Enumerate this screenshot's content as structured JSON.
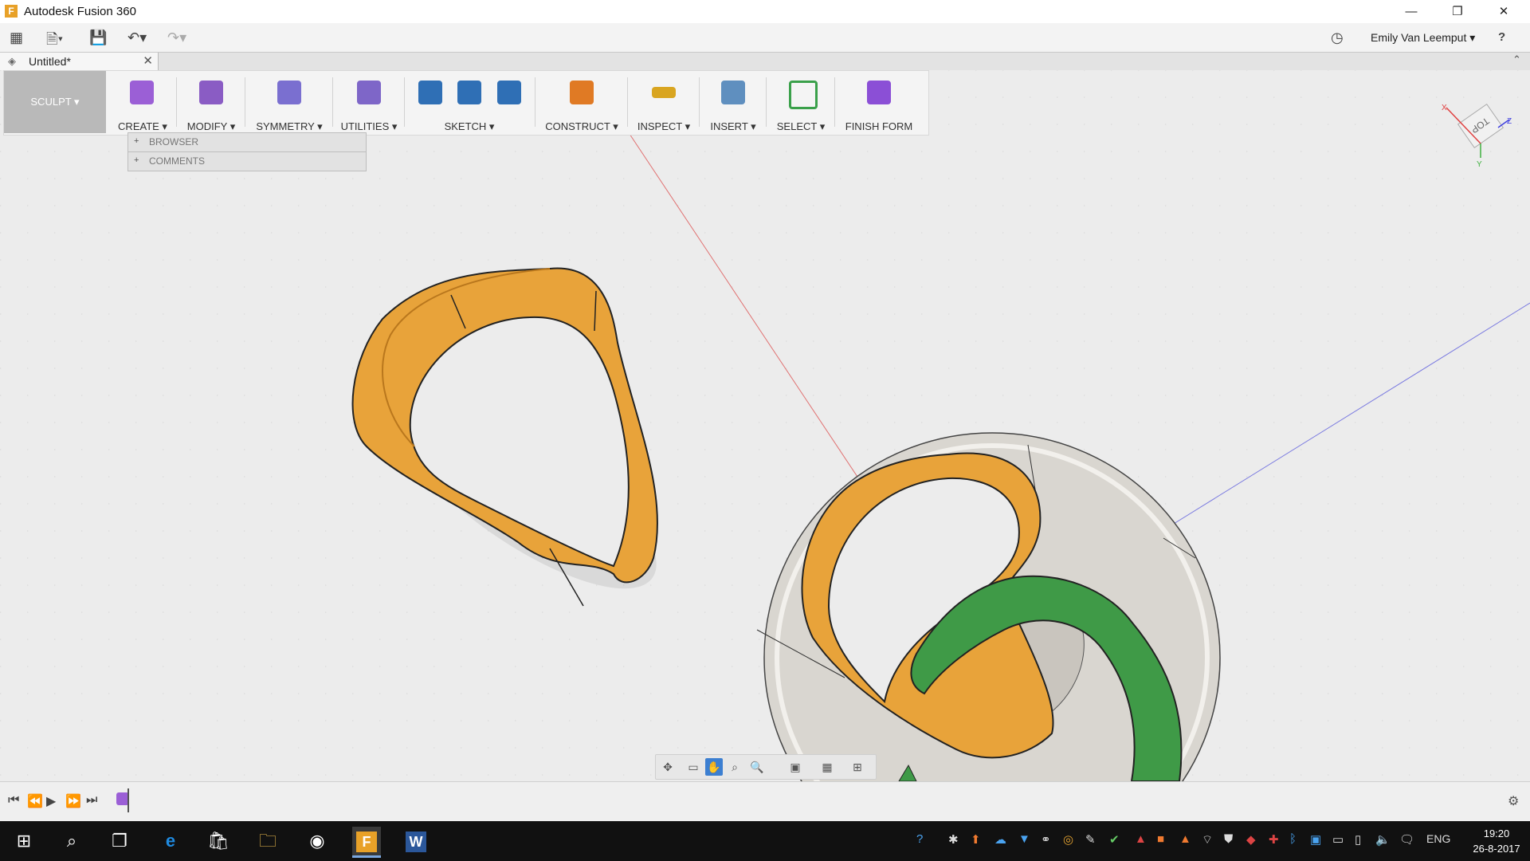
{
  "window": {
    "title": "Autodesk Fusion 360",
    "minimize": "—",
    "restore": "❐",
    "close": "✕"
  },
  "quickbar": {
    "user": "Emily Van Leemput ▾",
    "help": "?"
  },
  "document_tab": {
    "title": "Untitled*",
    "close": "✕"
  },
  "toolbar": {
    "workspace": "SCULPT ▾",
    "groups": [
      {
        "label": "CREATE ▾",
        "color": "#9b5fd6"
      },
      {
        "label": "MODIFY ▾",
        "color": "#8a5cc4"
      },
      {
        "label": "SYMMETRY ▾",
        "color": "#7a6fd0"
      },
      {
        "label": "UTILITIES ▾",
        "color": "#7e66c8"
      },
      {
        "label": "SKETCH ▾",
        "color": "#2f6fb5"
      },
      {
        "label": "CONSTRUCT ▾",
        "color": "#e07a24"
      },
      {
        "label": "INSPECT ▾",
        "color": "#d9a520"
      },
      {
        "label": "INSERT ▾",
        "color": "#5f8fbf"
      },
      {
        "label": "SELECT ▾",
        "color": "#3aa04a"
      },
      {
        "label": "FINISH FORM",
        "color": "#8b4fd6"
      }
    ]
  },
  "browser_panel": {
    "items": [
      "BROWSER",
      "COMMENTS"
    ],
    "toggle": "+"
  },
  "viewcube": {
    "face": "TOP",
    "x": "X",
    "y": "Y",
    "z": "Z"
  },
  "colors": {
    "accent_orange": "#e8a33a",
    "accent_green": "#3f9a47",
    "surface_grey": "#d9d6d0"
  },
  "taskbar": {
    "lang": "ENG",
    "time": "19:20",
    "date": "26-8-2017"
  }
}
